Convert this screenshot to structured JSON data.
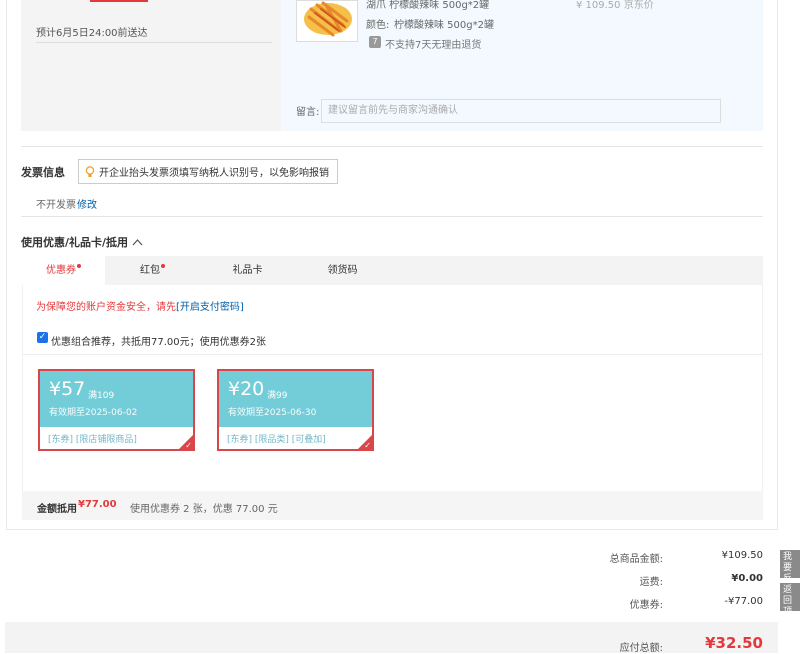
{
  "order": {
    "delivery_text": "预计6月5日24:00前送达",
    "product_name": "湖爪 柠檬酸辣味 500g*2罐",
    "product_color_label": "颜色:",
    "product_color_value": "柠檬酸辣味 500g*2罐",
    "no_return_icon": "7",
    "no_return_text": "不支持7天无理由退货",
    "product_price": "¥ 109.50 京东价",
    "note_label": "留言:",
    "note_placeholder": "建议留言前先与商家沟通确认"
  },
  "invoice": {
    "title": "发票信息",
    "tip": "开企业抬头发票须填写纳税人识别号，以免影响报销",
    "status": "不开发票",
    "edit_label": "修改"
  },
  "coupons": {
    "section_title": "使用优惠/礼品卡/抵用",
    "tabs": [
      {
        "label": "优惠券",
        "dot": true
      },
      {
        "label": "红包",
        "dot": true
      },
      {
        "label": "礼品卡",
        "dot": false
      },
      {
        "label": "领货码",
        "dot": false
      }
    ],
    "security_warning": "为保障您的账户资金安全，请先",
    "security_link": "[开启支付密码]",
    "combo_text": "优惠组合推荐，共抵用77.00元；使用优惠券2张",
    "items": [
      {
        "amount": "¥57",
        "condition": "满109",
        "valid": "有效期至2025-06-02",
        "tags": "[东券]  [限店铺限商品]"
      },
      {
        "amount": "¥20",
        "condition": "满99",
        "valid": "有效期至2025-06-30",
        "tags": "[东券]  [限品类]  [可叠加]"
      }
    ],
    "deduct_label": "金额抵用",
    "deduct_amount": "¥77.00",
    "deduct_desc": "使用优惠券 2 张，优惠 77.00 元"
  },
  "totals": {
    "goods_label": "总商品金额:",
    "goods_value": "¥109.50",
    "freight_label": "运费:",
    "freight_value": "¥0.00",
    "coupon_label": "优惠券:",
    "coupon_value": "-¥77.00",
    "payable_label": "应付总额:",
    "payable_value": "¥32.50"
  },
  "side": {
    "feedback": "我要反馈",
    "top": "返回顶部"
  },
  "colors": {
    "accent_red": "#e4393c",
    "coupon_teal": "#72cdd8",
    "link_blue": "#005ea7"
  }
}
